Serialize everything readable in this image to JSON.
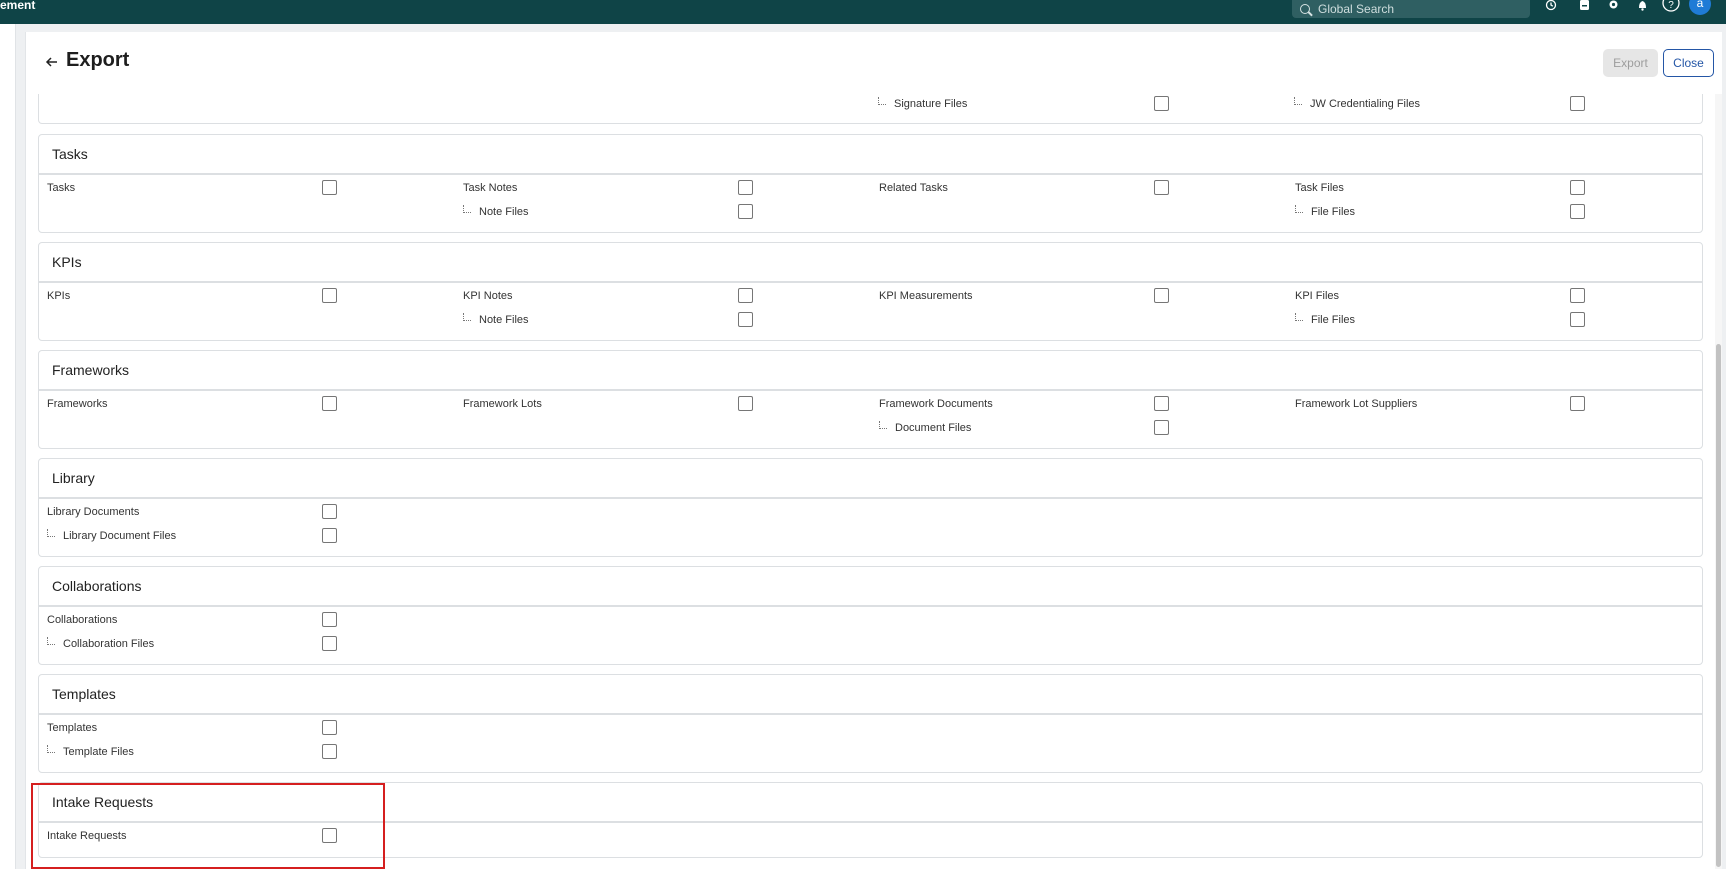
{
  "app_title": "ement",
  "search": {
    "placeholder": "Global Search"
  },
  "avatar_initial": "a",
  "help_symbol": "?",
  "icons": [
    "history-icon",
    "clipboard-icon",
    "gear-icon",
    "bell-icon",
    "help-icon"
  ],
  "panel": {
    "title": "Export",
    "export_label": "Export",
    "close_label": "Close"
  },
  "top_partial": {
    "items": [
      "Signature Files",
      "JW Credentialing Files"
    ]
  },
  "sections": {
    "tasks": {
      "title": "Tasks",
      "items": [
        "Tasks",
        "Task Notes",
        "Note Files",
        "Related Tasks",
        "Task Files",
        "File Files"
      ]
    },
    "kpis": {
      "title": "KPIs",
      "items": [
        "KPIs",
        "KPI Notes",
        "Note Files",
        "KPI Measurements",
        "KPI Files",
        "File Files"
      ]
    },
    "frameworks": {
      "title": "Frameworks",
      "items": [
        "Frameworks",
        "Framework Lots",
        "Framework Documents",
        "Document Files",
        "Framework Lot Suppliers"
      ]
    },
    "library": {
      "title": "Library",
      "items": [
        "Library Documents",
        "Library Document Files"
      ]
    },
    "collaborations": {
      "title": "Collaborations",
      "items": [
        "Collaborations",
        "Collaboration Files"
      ]
    },
    "templates": {
      "title": "Templates",
      "items": [
        "Templates",
        "Template Files"
      ]
    },
    "intake": {
      "title": "Intake Requests",
      "items": [
        "Intake Requests"
      ]
    }
  },
  "colors": {
    "topbar": "#0f4447",
    "accent": "#2456a6",
    "highlight": "#d51f1f"
  }
}
